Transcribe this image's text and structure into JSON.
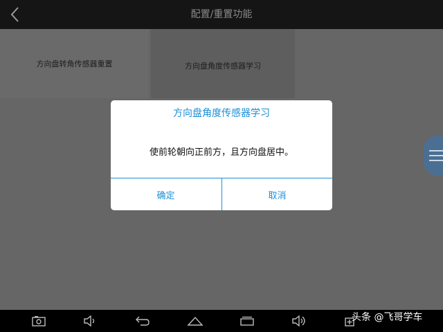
{
  "header": {
    "title": "配置/重置功能",
    "back_icon": "chevron-left-icon"
  },
  "tiles": [
    {
      "label": "方向盘转角传感器重置"
    },
    {
      "label": "方向盘角度传感器学习"
    }
  ],
  "dialog": {
    "title": "方向盘角度传感器学习",
    "message": "使前轮朝向正前方，且方向盘居中。",
    "ok_label": "确定",
    "cancel_label": "取消",
    "accent_color": "#1b8fd6"
  },
  "side_menu": {
    "icon": "menu-icon"
  },
  "navbar": {
    "icons": [
      "screenshot-icon",
      "volume-down-icon",
      "back-icon",
      "home-icon",
      "recent-apps-icon",
      "volume-up-icon",
      "add-icon"
    ]
  },
  "watermark": {
    "text": "头条 @飞哥学车"
  }
}
